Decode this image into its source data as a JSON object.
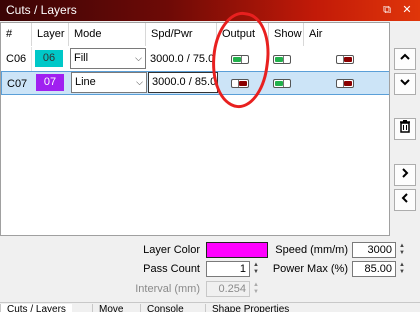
{
  "window": {
    "title": "Cuts / Layers",
    "restore_glyph": "⧉",
    "close_glyph": "✕"
  },
  "grid": {
    "headers": [
      "#",
      "Layer",
      "Mode",
      "Spd/Pwr",
      "Output",
      "Show",
      "Air"
    ],
    "rows": [
      {
        "num": "C06",
        "layer": "06",
        "layer_color": "#00c8c8",
        "mode": "Fill",
        "spdpwr": "3000.0 / 75.0",
        "output": "on",
        "show": "on",
        "air": "off"
      },
      {
        "num": "C07",
        "layer": "07",
        "layer_color": "#a020f0",
        "mode": "Line",
        "spdpwr": "3000.0 / 85.0",
        "output": "off",
        "show": "on",
        "air": "off"
      }
    ]
  },
  "side_buttons": {
    "up": "˄",
    "down": "˅",
    "delete": "trash-icon",
    "right": "›",
    "left": "‹"
  },
  "properties": {
    "layer_color_label": "Layer Color",
    "layer_color": "#ff00ff",
    "speed_label": "Speed (mm/m)",
    "speed_value": "3000",
    "pass_count_label": "Pass Count",
    "pass_count_value": "1",
    "power_max_label": "Power Max (%)",
    "power_max_value": "85.00",
    "interval_label": "Interval (mm)",
    "interval_value": "0.254"
  },
  "tabs": [
    "Cuts / Layers",
    "Move",
    "Console",
    "Shape Properties"
  ],
  "annotation": {
    "color": "#e8201f"
  }
}
